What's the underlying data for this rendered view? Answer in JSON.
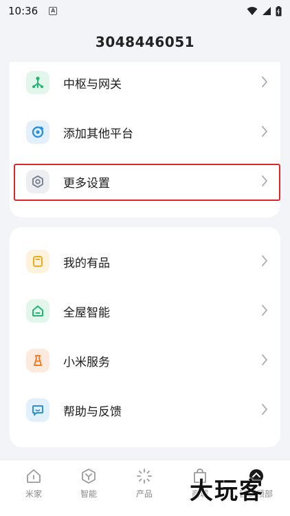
{
  "status_bar": {
    "time": "10:36",
    "notification_glyph": "A"
  },
  "header": {
    "title": "3048446051"
  },
  "top_group": [
    {
      "label": "中枢与网关",
      "icon": "hub-icon",
      "color": "#22b574",
      "bg": "#e3f6ec"
    },
    {
      "label": "添加其他平台",
      "icon": "add-platform-icon",
      "color": "#2b8fe0",
      "bg": "#e2f0fc"
    },
    {
      "label": "更多设置",
      "icon": "settings-icon",
      "color": "#7b8290",
      "bg": "#eceef2"
    }
  ],
  "bottom_group": [
    {
      "label": "我的有品",
      "icon": "youpin-icon",
      "color": "#f0a81c",
      "bg": "#fdf3dd"
    },
    {
      "label": "全屋智能",
      "icon": "smart-home-icon",
      "color": "#22b574",
      "bg": "#e3f6ec"
    },
    {
      "label": "小米服务",
      "icon": "service-icon",
      "color": "#f07b23",
      "bg": "#fdeade"
    },
    {
      "label": "帮助与反馈",
      "icon": "feedback-icon",
      "color": "#2b8fe0",
      "bg": "#e2f0fc"
    }
  ],
  "bottom_nav": [
    {
      "label": "米家",
      "icon": "home-icon"
    },
    {
      "label": "智能",
      "icon": "smart-icon"
    },
    {
      "label": "产品",
      "icon": "product-icon"
    },
    {
      "label": "商城",
      "icon": "mall-icon"
    },
    {
      "label": "回到顶部",
      "icon": "back-to-top-icon"
    }
  ],
  "watermark": "大玩客",
  "highlight_color": "#e0242b"
}
